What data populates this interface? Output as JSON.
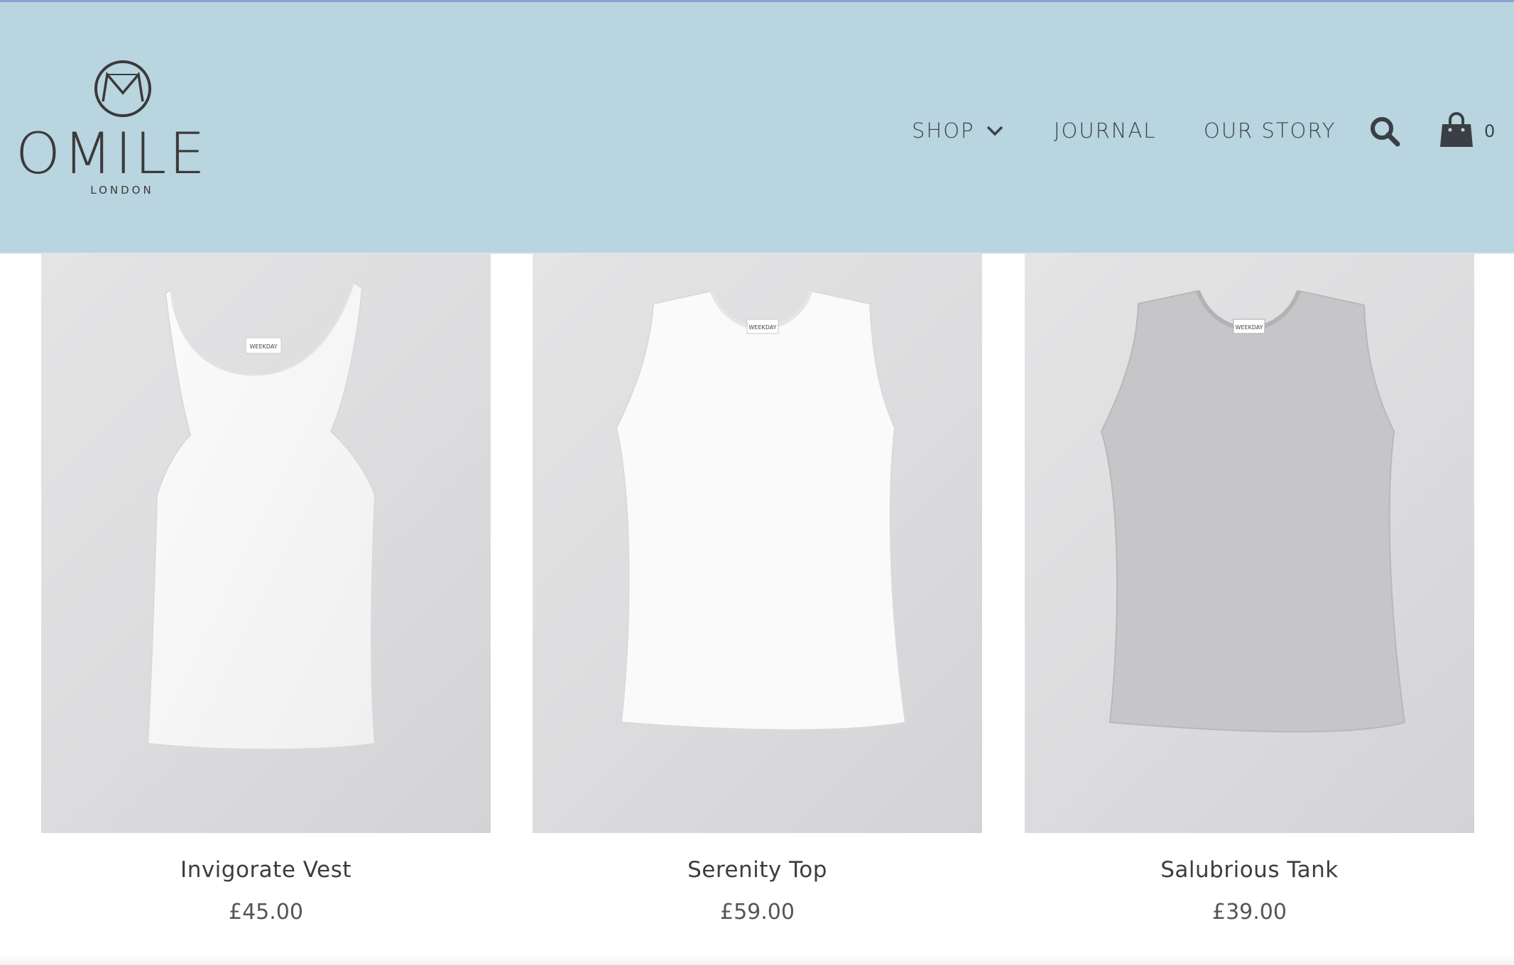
{
  "header": {
    "logo": {
      "word": "OMILE",
      "sub": "LONDON"
    },
    "nav": {
      "shop": "SHOP",
      "journal": "JOURNAL",
      "our_story": "OUR STORY"
    },
    "cart_count": "0"
  },
  "products": [
    {
      "name": "Invigorate Vest",
      "price": "£45.00",
      "tag": "WEEKDAY"
    },
    {
      "name": "Serenity Top",
      "price": "£59.00",
      "tag": "WEEKDAY"
    },
    {
      "name": "Salubrious Tank",
      "price": "£39.00",
      "tag": "WEEKDAY"
    }
  ],
  "colors": {
    "header_bg": "#b9d5df",
    "text_dark": "#3d4349",
    "image_bg": "#dcdcde",
    "grey_tank": "#c4c4c6"
  }
}
